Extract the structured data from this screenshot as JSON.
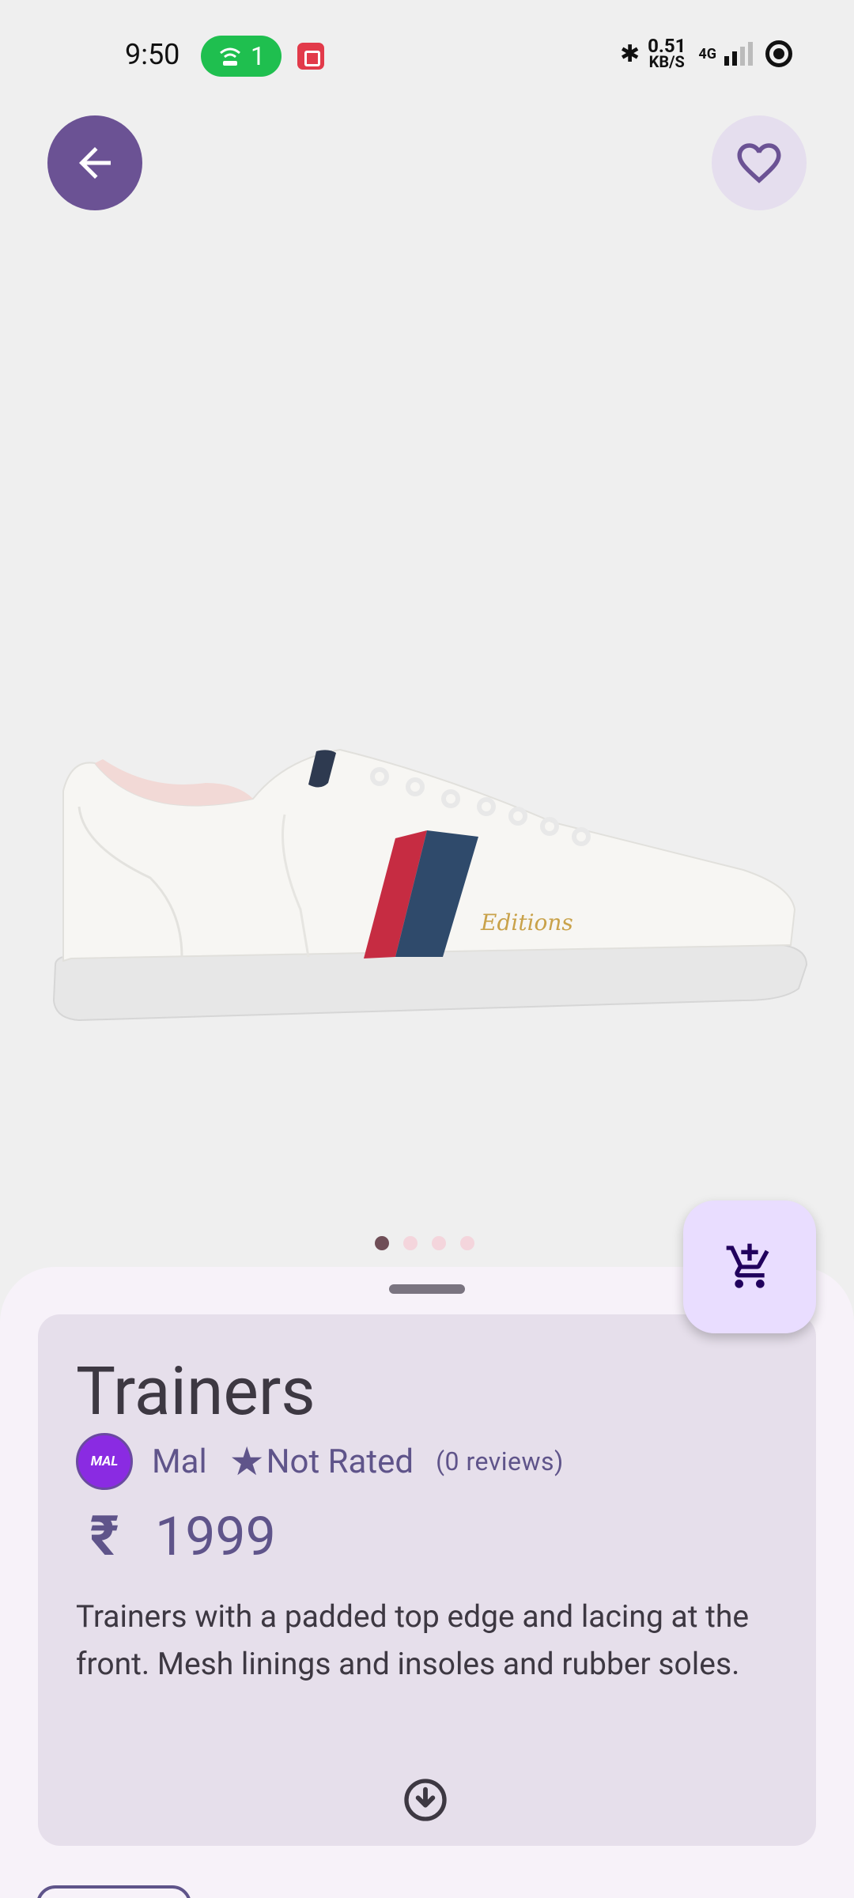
{
  "status_bar": {
    "time": "9:50",
    "hotspot_count": "1",
    "net_speed_value": "0.51",
    "net_speed_unit": "KB/S",
    "network_type": "4G"
  },
  "product": {
    "title": "Trainers",
    "brand_logo_text": "MAL",
    "brand": "Mal",
    "rating": "Not Rated",
    "reviews": "(0 reviews)",
    "currency_symbol": "₹",
    "price": "1999",
    "description": "Trainers with a padded top edge and lacing at the front. Mesh linings and insoles and rubber soles.",
    "shoe_brand_text": "Editions"
  },
  "carousel": {
    "total": 4,
    "active_index": 0
  },
  "colors": {
    "primary": "#6b5294",
    "fab_bg": "#e9ddff",
    "card_bg": "#e6dfeb",
    "brand_purple": "#8a2be2"
  }
}
